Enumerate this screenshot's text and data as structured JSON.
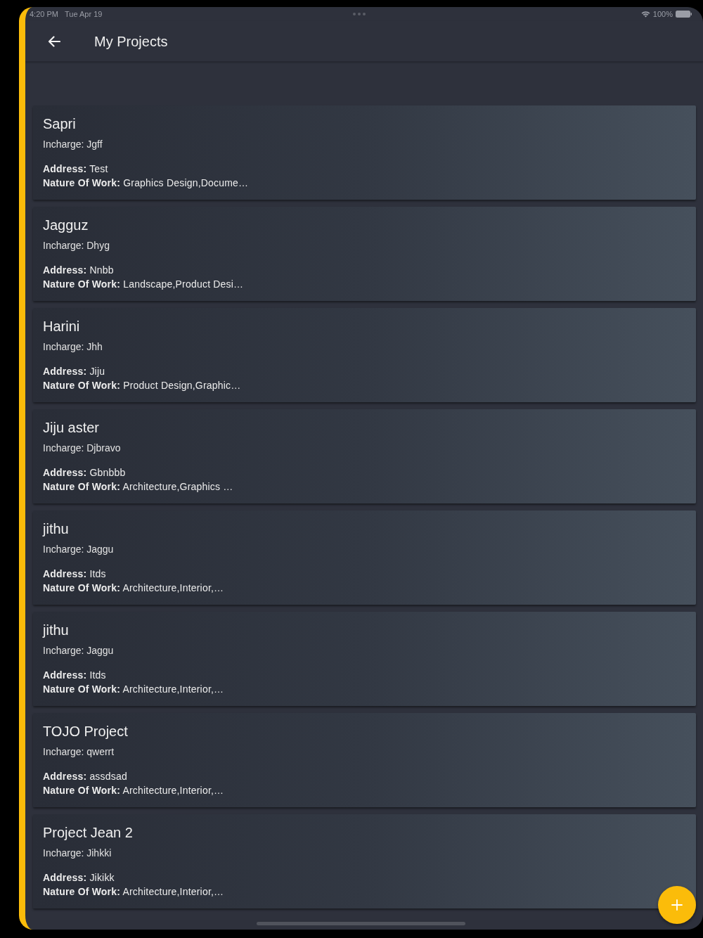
{
  "status_bar": {
    "time": "4:20 PM",
    "date": "Tue Apr 19",
    "battery": "100%"
  },
  "app_bar": {
    "title": "My Projects"
  },
  "projects": [
    {
      "name": "Sapri",
      "incharge": "Incharge: Jgff",
      "address": "**Address:** Test",
      "nature_of_work": "**Nature Of Work:** Graphics Design,Docume…"
    },
    {
      "name": "Jagguz",
      "incharge": "Incharge: Dhyg",
      "address": "**Address:** Nnbb",
      "nature_of_work": "**Nature Of Work:** Landscape,Product Desi…"
    },
    {
      "name": "Harini",
      "incharge": "Incharge: Jhh",
      "address": "**Address:** Jiju",
      "nature_of_work": "**Nature Of Work:** Product Design,Graphic…"
    },
    {
      "name": "Jiju aster",
      "incharge": "Incharge: Djbravo",
      "address": "**Address:** Gbnbbb",
      "nature_of_work": "**Nature Of Work:** Architecture,Graphics …"
    },
    {
      "name": "jithu",
      "incharge": "Incharge: Jaggu",
      "address": "**Address:** Itds",
      "nature_of_work": "**Nature Of Work:** Architecture,Interior,…"
    },
    {
      "name": "jithu",
      "incharge": "Incharge: Jaggu",
      "address": "**Address:** Itds",
      "nature_of_work": "**Nature Of Work:** Architecture,Interior,…"
    },
    {
      "name": "TOJO Project",
      "incharge": "Incharge: qwerrt",
      "address": "**Address:** assdsad",
      "nature_of_work": "**Nature Of Work:** Architecture,Interior,…"
    },
    {
      "name": "Project Jean 2",
      "incharge": "Incharge: Jihkki",
      "address": "**Address:** Jikikk",
      "nature_of_work": "**Nature Of Work:** Architecture,Interior,…"
    }
  ]
}
